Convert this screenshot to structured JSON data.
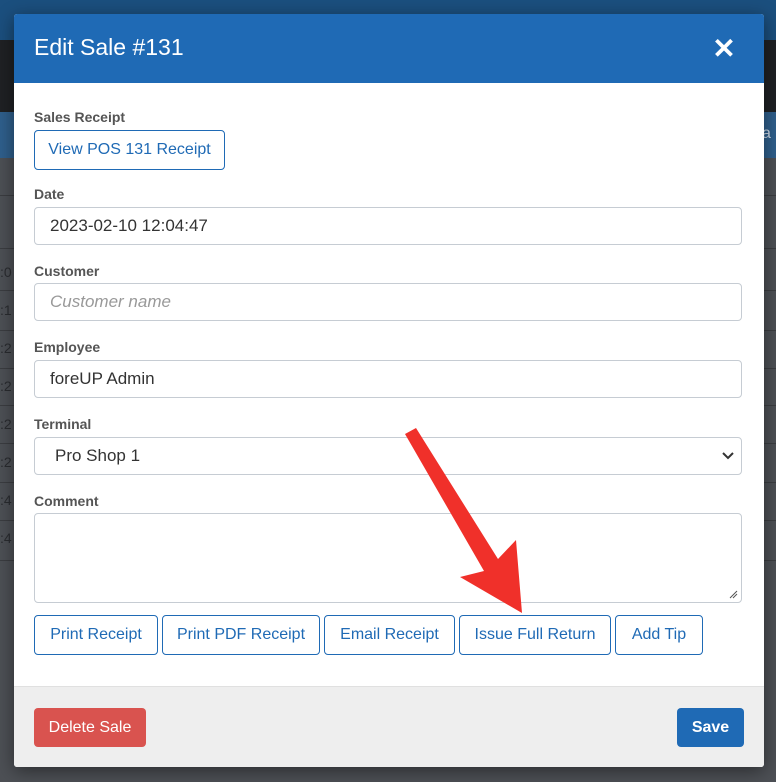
{
  "background": {
    "row_stubs": [
      ":0",
      ":1",
      ":2",
      ":2",
      ":2",
      ":2",
      ":4",
      ":4"
    ],
    "right_text": "a"
  },
  "modal": {
    "title": "Edit Sale #131",
    "close_icon": "close-icon"
  },
  "form": {
    "sales_receipt": {
      "label": "Sales Receipt",
      "button": "View POS 131 Receipt"
    },
    "date": {
      "label": "Date",
      "value": "2023-02-10 12:04:47"
    },
    "customer": {
      "label": "Customer",
      "placeholder": "Customer name",
      "value": ""
    },
    "employee": {
      "label": "Employee",
      "value": "foreUP Admin"
    },
    "terminal": {
      "label": "Terminal",
      "value": "Pro Shop 1"
    },
    "comment": {
      "label": "Comment",
      "value": ""
    }
  },
  "actions": {
    "print_receipt": "Print Receipt",
    "print_pdf_receipt": "Print PDF Receipt",
    "email_receipt": "Email Receipt",
    "issue_full_return": "Issue Full Return",
    "add_tip": "Add Tip"
  },
  "footer": {
    "delete_sale": "Delete Sale",
    "save": "Save"
  },
  "colors": {
    "primary": "#1f6ab5",
    "danger": "#d9534f",
    "annotation_arrow": "#f0302a"
  }
}
